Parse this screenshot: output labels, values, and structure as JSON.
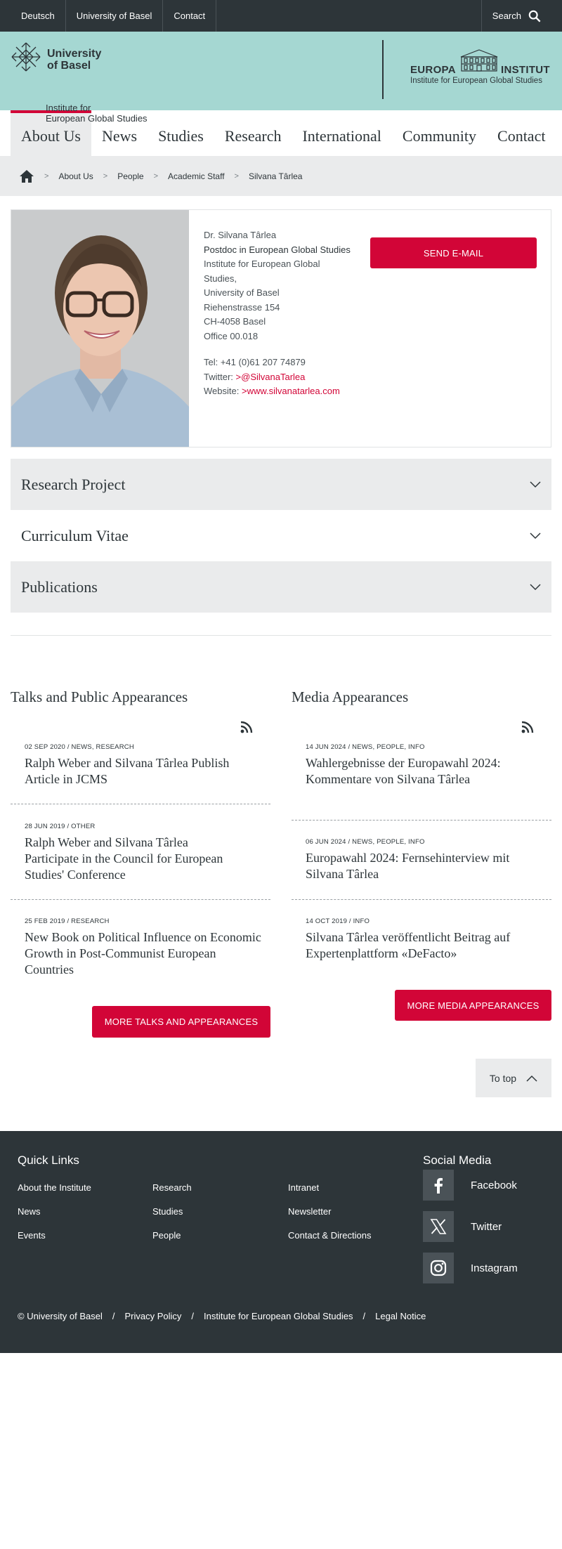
{
  "topbar": {
    "links": [
      "Deutsch",
      "University of Basel",
      "Contact"
    ],
    "search_label": "Search"
  },
  "header": {
    "university_name": "University\nof Basel",
    "institute_line1": "Institute for",
    "institute_line2": "European Global Studies",
    "europa_word1": "EUROPA",
    "europa_word2": "INSTITUT",
    "europa_sub": "Institute for European Global Studies"
  },
  "nav": [
    "About Us",
    "News",
    "Studies",
    "Research",
    "International",
    "Community",
    "Contact"
  ],
  "breadcrumb": [
    "About Us",
    "People",
    "Academic Staff",
    "Silvana Târlea"
  ],
  "profile": {
    "name": "Dr. Silvana Târlea",
    "role": "Postdoc in European Global Studies",
    "address": [
      "Institute for European Global Studies,",
      "University of Basel",
      "Riehenstrasse 154",
      "CH-4058 Basel",
      "Office 00.018"
    ],
    "tel": "Tel: +41 (0)61 207 74879",
    "twitter_label": "Twitter:",
    "twitter_handle": "@SilvanaTarlea",
    "website_label": "Website:",
    "website_url": "www.silvanatarlea.com",
    "send_email": "Send E-Mail"
  },
  "accordions": [
    "Research Project",
    "Curriculum Vitae",
    "Publications"
  ],
  "talks": {
    "title": "Talks and Public Appearances",
    "items": [
      {
        "meta": "02 SEP 2020 / NEWS, RESEARCH",
        "headline": "Ralph Weber and Silvana Târlea Publish Article in JCMS"
      },
      {
        "meta": "28 JUN 2019 / OTHER",
        "headline": "Ralph Weber and Silvana Târlea Participate in the Council for European Studies' Conference"
      },
      {
        "meta": "25 FEB 2019 / RESEARCH",
        "headline": "New Book on Political Influence on Economic Growth in Post-Communist European Countries"
      }
    ],
    "more": "More Talks and Appearances"
  },
  "media": {
    "title": "Media Appearances",
    "items": [
      {
        "meta": "14 JUN 2024 / NEWS, PEOPLE, INFO",
        "headline": "Wahlergebnisse der Europawahl 2024: Kommentare von Silvana Târlea"
      },
      {
        "meta": "06 JUN 2024 / NEWS, PEOPLE, INFO",
        "headline": "Europawahl 2024: Fernsehinterview mit Silvana Târlea"
      },
      {
        "meta": "14 OCT 2019 / INFO",
        "headline": "Silvana Târlea veröffentlicht Beitrag auf Expertenplattform «DeFacto»"
      }
    ],
    "more": "More Media Appearances"
  },
  "to_top": "To top",
  "footer": {
    "quick_links_title": "Quick Links",
    "quick_links": [
      [
        "About the Institute",
        "News",
        "Events"
      ],
      [
        "Research",
        "Studies",
        "People"
      ],
      [
        "Intranet",
        "Newsletter",
        "Contact & Directions"
      ]
    ],
    "social_title": "Social Media",
    "social": [
      "Facebook",
      "Twitter",
      "Instagram"
    ],
    "bottom": [
      "© University of Basel",
      "Privacy Policy",
      "Institute for European Global Studies",
      "Legal Notice"
    ],
    "bottom_sep": "/"
  },
  "colors": {
    "accent": "#d20537",
    "header_bg": "#a5d7d2",
    "dark": "#2d3539",
    "light_grey": "#eaebec"
  }
}
